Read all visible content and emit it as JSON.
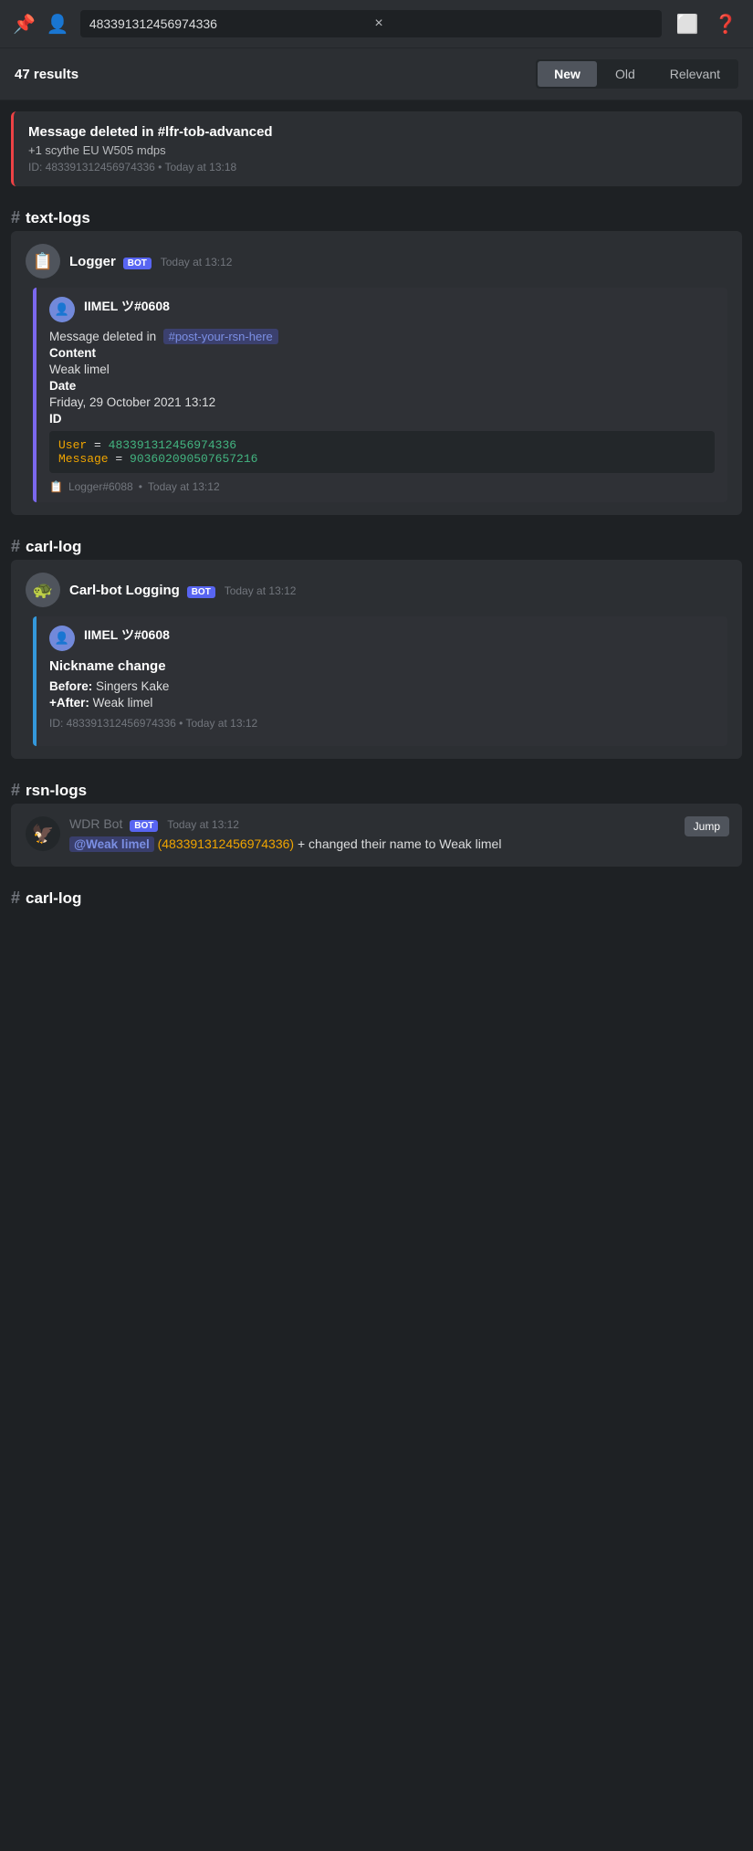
{
  "topbar": {
    "search_value": "483391312456974336",
    "close_label": "×",
    "chat_icon": "💬",
    "help_icon": "?"
  },
  "results": {
    "count": "47 results",
    "filters": [
      {
        "label": "New",
        "active": true
      },
      {
        "label": "Old",
        "active": false
      },
      {
        "label": "Relevant",
        "active": false
      }
    ]
  },
  "deleted_top": {
    "title": "Message deleted in #lfr-tob-advanced",
    "subtitle": "+1 scythe EU W505 mdps",
    "meta": "ID: 483391312456974336 • Today at 13:18"
  },
  "text_logs_section": {
    "channel_hash": "#",
    "channel_name": "text-logs",
    "message": {
      "author": "Logger",
      "bot_badge": "BOT",
      "timestamp": "Today at 13:12",
      "embed": {
        "user_name": "IIMEL ツ#0608",
        "deleted_in_text": "Message deleted in",
        "channel_tag": "#post-your-rsn-here",
        "content_label": "Content",
        "content_value": "Weak limel",
        "date_label": "Date",
        "date_value": "Friday, 29 October 2021 13:12",
        "id_label": "ID",
        "user_key": "User",
        "user_value": "483391312456974336",
        "message_key": "Message",
        "message_value": "903602090507657216",
        "footer_name": "Logger#6088",
        "footer_time": "Today at 13:12"
      }
    }
  },
  "carl_log_section": {
    "channel_hash": "#",
    "channel_name": "carl-log",
    "message": {
      "author": "Carl-bot Logging",
      "bot_badge": "BOT",
      "timestamp": "Today at 13:12",
      "embed": {
        "user_name": "IIMEL ツ#0608",
        "event_title": "Nickname change",
        "before_label": "Before:",
        "before_value": "Singers Kake",
        "after_label": "+After:",
        "after_value": "Weak limel",
        "meta": "ID: 483391312456974336 • Today at 13:12"
      }
    }
  },
  "rsn_logs_section": {
    "channel_hash": "#",
    "channel_name": "rsn-logs",
    "message": {
      "author": "WDR Bot",
      "bot_badge": "BOT",
      "timestamp": "Today at 13:12",
      "jump_label": "Jump",
      "mention": "@Weak limel",
      "id_part": "(483391312456974336)",
      "text_suffix": "+ changed their name to Weak limel"
    }
  },
  "carl_log_section2": {
    "channel_hash": "#",
    "channel_name": "carl-log"
  }
}
